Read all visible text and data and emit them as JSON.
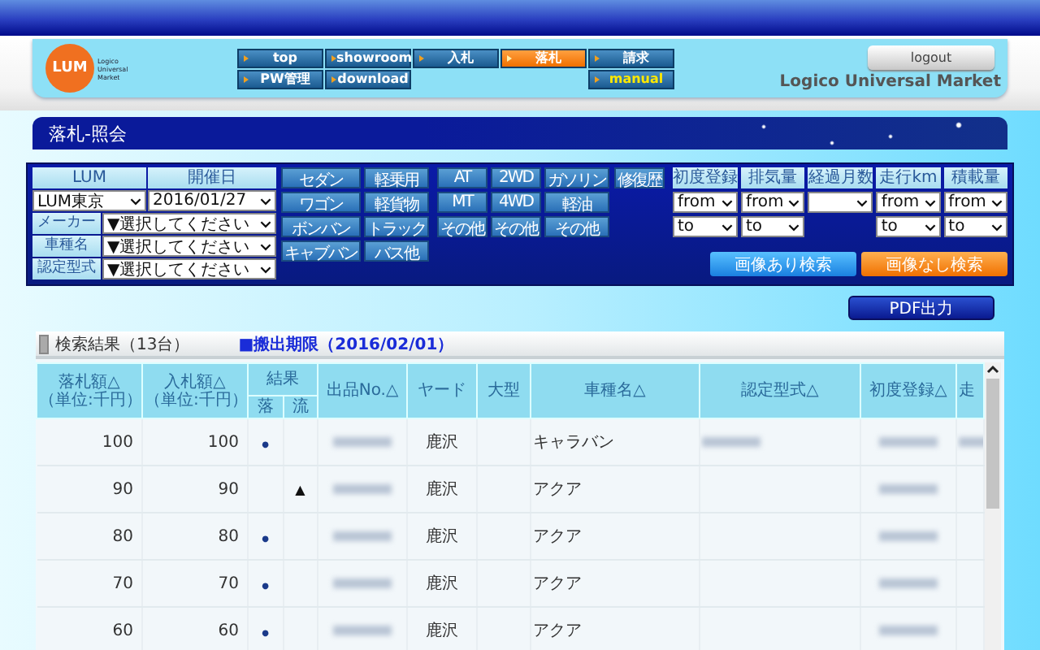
{
  "header": {
    "logo_mark": "LUM",
    "logo_lines": [
      "Logico",
      "Universal",
      "Market"
    ],
    "nav": [
      {
        "label": "top",
        "kind": "link",
        "selected": false
      },
      {
        "label": "showroom",
        "kind": "link",
        "selected": false
      },
      {
        "label": "入札",
        "kind": "link",
        "selected": false
      },
      {
        "label": "落札",
        "kind": "link",
        "selected": true
      },
      {
        "label": "請求",
        "kind": "link",
        "selected": false
      },
      {
        "label": "PW管理",
        "kind": "link",
        "selected": false
      },
      {
        "label": "download",
        "kind": "link",
        "selected": false
      },
      {
        "label": "manual",
        "kind": "manual",
        "selected": false
      }
    ],
    "logout": "logout",
    "brand": "Logico Universal Market"
  },
  "page_title": "落札-照会",
  "search": {
    "top_fields": [
      {
        "label": "LUM",
        "value": "LUM東京"
      },
      {
        "label": "開催日",
        "value": "2016/01/27"
      }
    ],
    "filters": [
      {
        "label": "メーカー",
        "value": "▼選択してください"
      },
      {
        "label": "車種名",
        "value": "▼選択してください"
      },
      {
        "label": "認定型式",
        "value": "▼選択してください"
      }
    ],
    "body_types": [
      "セダン",
      "軽乗用",
      "ワゴン",
      "軽貨物",
      "ボンバン",
      "トラック",
      "キャブバン",
      "バス他"
    ],
    "specs": [
      "AT",
      "2WD",
      "ガソリン",
      "MT",
      "4WD",
      "軽油",
      "その他",
      "その他",
      "その他"
    ],
    "repair": "修復歴",
    "ranges": [
      {
        "label": "初度登録",
        "kind": "range",
        "from": "from",
        "to": "to"
      },
      {
        "label": "排気量",
        "kind": "range",
        "from": "from",
        "to": "to"
      },
      {
        "label": "経過月数",
        "kind": "single"
      },
      {
        "label": "走行km",
        "kind": "range",
        "from": "from",
        "to": "to"
      },
      {
        "label": "積載量",
        "kind": "range",
        "from": "from",
        "to": "to"
      }
    ],
    "buttons": [
      {
        "label": "画像あり検索",
        "kind": "primary"
      },
      {
        "label": "画像なし検索",
        "kind": "accent"
      }
    ]
  },
  "pdf_button": "PDF出力",
  "results": {
    "title": "検索結果（13台）",
    "deadline": "■搬出期限（2016/02/01）",
    "columns": [
      {
        "label": "落札額△",
        "sub": "（単位:千円）"
      },
      {
        "label": "入札額△",
        "sub": "（単位:千円）"
      },
      {
        "label": "結果",
        "children": [
          "落",
          "流"
        ]
      },
      {
        "label": "出品No.△"
      },
      {
        "label": "ヤード"
      },
      {
        "label": "大型"
      },
      {
        "label": "車種名△"
      },
      {
        "label": "認定型式△"
      },
      {
        "label": "初度登録△"
      },
      {
        "label": "走"
      }
    ],
    "rows": [
      {
        "winning_bid": "100",
        "bid": "100",
        "won": "●",
        "yard": "鹿沢",
        "model": "キャラバン",
        "blurred": {
          "lot_no": true,
          "model_code": true,
          "first_reg": true,
          "mileage": true
        }
      },
      {
        "winning_bid": "90",
        "bid": "90",
        "passed": "▲",
        "yard": "鹿沢",
        "model": "アクア",
        "blurred": {
          "lot_no": true,
          "model_code": false,
          "first_reg": true,
          "mileage": false
        }
      },
      {
        "winning_bid": "80",
        "bid": "80",
        "won": "●",
        "yard": "鹿沢",
        "model": "アクア",
        "blurred": {
          "lot_no": true,
          "model_code": false,
          "first_reg": true,
          "mileage": false
        }
      },
      {
        "winning_bid": "70",
        "bid": "70",
        "won": "●",
        "yard": "鹿沢",
        "model": "アクア",
        "blurred": {
          "lot_no": true,
          "model_code": false,
          "first_reg": true,
          "mileage": false
        }
      },
      {
        "winning_bid": "60",
        "bid": "60",
        "won": "●",
        "yard": "鹿沢",
        "model": "アクア",
        "blurred": {
          "lot_no": true,
          "model_code": false,
          "first_reg": true,
          "mileage": false
        }
      }
    ]
  }
}
